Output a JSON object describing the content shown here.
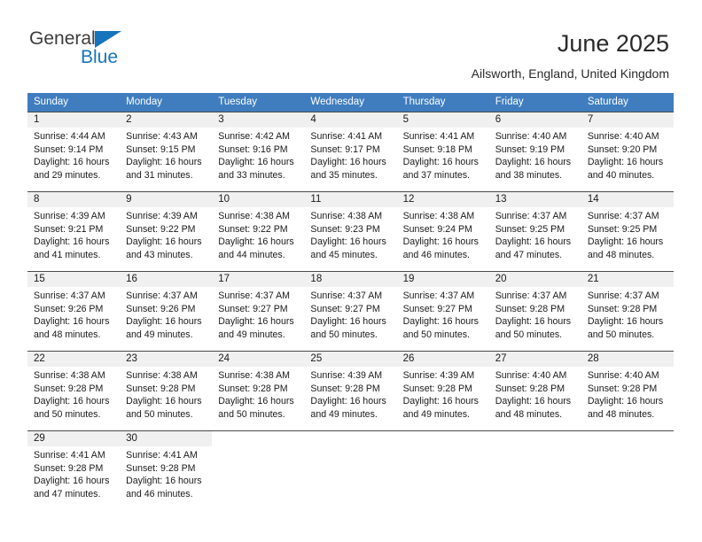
{
  "brand": {
    "name_part1": "General",
    "name_part2": "Blue",
    "accent_color": "#1574bb"
  },
  "header": {
    "title": "June 2025",
    "location": "Ailsworth, England, United Kingdom"
  },
  "calendar": {
    "header_bg": "#3f7dbf",
    "day_band_bg": "#f0f0f0",
    "weekdays": [
      "Sunday",
      "Monday",
      "Tuesday",
      "Wednesday",
      "Thursday",
      "Friday",
      "Saturday"
    ],
    "weeks": [
      [
        {
          "day": "1",
          "sunrise": "Sunrise: 4:44 AM",
          "sunset": "Sunset: 9:14 PM",
          "daylight": "Daylight: 16 hours and 29 minutes."
        },
        {
          "day": "2",
          "sunrise": "Sunrise: 4:43 AM",
          "sunset": "Sunset: 9:15 PM",
          "daylight": "Daylight: 16 hours and 31 minutes."
        },
        {
          "day": "3",
          "sunrise": "Sunrise: 4:42 AM",
          "sunset": "Sunset: 9:16 PM",
          "daylight": "Daylight: 16 hours and 33 minutes."
        },
        {
          "day": "4",
          "sunrise": "Sunrise: 4:41 AM",
          "sunset": "Sunset: 9:17 PM",
          "daylight": "Daylight: 16 hours and 35 minutes."
        },
        {
          "day": "5",
          "sunrise": "Sunrise: 4:41 AM",
          "sunset": "Sunset: 9:18 PM",
          "daylight": "Daylight: 16 hours and 37 minutes."
        },
        {
          "day": "6",
          "sunrise": "Sunrise: 4:40 AM",
          "sunset": "Sunset: 9:19 PM",
          "daylight": "Daylight: 16 hours and 38 minutes."
        },
        {
          "day": "7",
          "sunrise": "Sunrise: 4:40 AM",
          "sunset": "Sunset: 9:20 PM",
          "daylight": "Daylight: 16 hours and 40 minutes."
        }
      ],
      [
        {
          "day": "8",
          "sunrise": "Sunrise: 4:39 AM",
          "sunset": "Sunset: 9:21 PM",
          "daylight": "Daylight: 16 hours and 41 minutes."
        },
        {
          "day": "9",
          "sunrise": "Sunrise: 4:39 AM",
          "sunset": "Sunset: 9:22 PM",
          "daylight": "Daylight: 16 hours and 43 minutes."
        },
        {
          "day": "10",
          "sunrise": "Sunrise: 4:38 AM",
          "sunset": "Sunset: 9:22 PM",
          "daylight": "Daylight: 16 hours and 44 minutes."
        },
        {
          "day": "11",
          "sunrise": "Sunrise: 4:38 AM",
          "sunset": "Sunset: 9:23 PM",
          "daylight": "Daylight: 16 hours and 45 minutes."
        },
        {
          "day": "12",
          "sunrise": "Sunrise: 4:38 AM",
          "sunset": "Sunset: 9:24 PM",
          "daylight": "Daylight: 16 hours and 46 minutes."
        },
        {
          "day": "13",
          "sunrise": "Sunrise: 4:37 AM",
          "sunset": "Sunset: 9:25 PM",
          "daylight": "Daylight: 16 hours and 47 minutes."
        },
        {
          "day": "14",
          "sunrise": "Sunrise: 4:37 AM",
          "sunset": "Sunset: 9:25 PM",
          "daylight": "Daylight: 16 hours and 48 minutes."
        }
      ],
      [
        {
          "day": "15",
          "sunrise": "Sunrise: 4:37 AM",
          "sunset": "Sunset: 9:26 PM",
          "daylight": "Daylight: 16 hours and 48 minutes."
        },
        {
          "day": "16",
          "sunrise": "Sunrise: 4:37 AM",
          "sunset": "Sunset: 9:26 PM",
          "daylight": "Daylight: 16 hours and 49 minutes."
        },
        {
          "day": "17",
          "sunrise": "Sunrise: 4:37 AM",
          "sunset": "Sunset: 9:27 PM",
          "daylight": "Daylight: 16 hours and 49 minutes."
        },
        {
          "day": "18",
          "sunrise": "Sunrise: 4:37 AM",
          "sunset": "Sunset: 9:27 PM",
          "daylight": "Daylight: 16 hours and 50 minutes."
        },
        {
          "day": "19",
          "sunrise": "Sunrise: 4:37 AM",
          "sunset": "Sunset: 9:27 PM",
          "daylight": "Daylight: 16 hours and 50 minutes."
        },
        {
          "day": "20",
          "sunrise": "Sunrise: 4:37 AM",
          "sunset": "Sunset: 9:28 PM",
          "daylight": "Daylight: 16 hours and 50 minutes."
        },
        {
          "day": "21",
          "sunrise": "Sunrise: 4:37 AM",
          "sunset": "Sunset: 9:28 PM",
          "daylight": "Daylight: 16 hours and 50 minutes."
        }
      ],
      [
        {
          "day": "22",
          "sunrise": "Sunrise: 4:38 AM",
          "sunset": "Sunset: 9:28 PM",
          "daylight": "Daylight: 16 hours and 50 minutes."
        },
        {
          "day": "23",
          "sunrise": "Sunrise: 4:38 AM",
          "sunset": "Sunset: 9:28 PM",
          "daylight": "Daylight: 16 hours and 50 minutes."
        },
        {
          "day": "24",
          "sunrise": "Sunrise: 4:38 AM",
          "sunset": "Sunset: 9:28 PM",
          "daylight": "Daylight: 16 hours and 50 minutes."
        },
        {
          "day": "25",
          "sunrise": "Sunrise: 4:39 AM",
          "sunset": "Sunset: 9:28 PM",
          "daylight": "Daylight: 16 hours and 49 minutes."
        },
        {
          "day": "26",
          "sunrise": "Sunrise: 4:39 AM",
          "sunset": "Sunset: 9:28 PM",
          "daylight": "Daylight: 16 hours and 49 minutes."
        },
        {
          "day": "27",
          "sunrise": "Sunrise: 4:40 AM",
          "sunset": "Sunset: 9:28 PM",
          "daylight": "Daylight: 16 hours and 48 minutes."
        },
        {
          "day": "28",
          "sunrise": "Sunrise: 4:40 AM",
          "sunset": "Sunset: 9:28 PM",
          "daylight": "Daylight: 16 hours and 48 minutes."
        }
      ],
      [
        {
          "day": "29",
          "sunrise": "Sunrise: 4:41 AM",
          "sunset": "Sunset: 9:28 PM",
          "daylight": "Daylight: 16 hours and 47 minutes."
        },
        {
          "day": "30",
          "sunrise": "Sunrise: 4:41 AM",
          "sunset": "Sunset: 9:28 PM",
          "daylight": "Daylight: 16 hours and 46 minutes."
        },
        {
          "day": "",
          "sunrise": "",
          "sunset": "",
          "daylight": ""
        },
        {
          "day": "",
          "sunrise": "",
          "sunset": "",
          "daylight": ""
        },
        {
          "day": "",
          "sunrise": "",
          "sunset": "",
          "daylight": ""
        },
        {
          "day": "",
          "sunrise": "",
          "sunset": "",
          "daylight": ""
        },
        {
          "day": "",
          "sunrise": "",
          "sunset": "",
          "daylight": ""
        }
      ]
    ]
  }
}
